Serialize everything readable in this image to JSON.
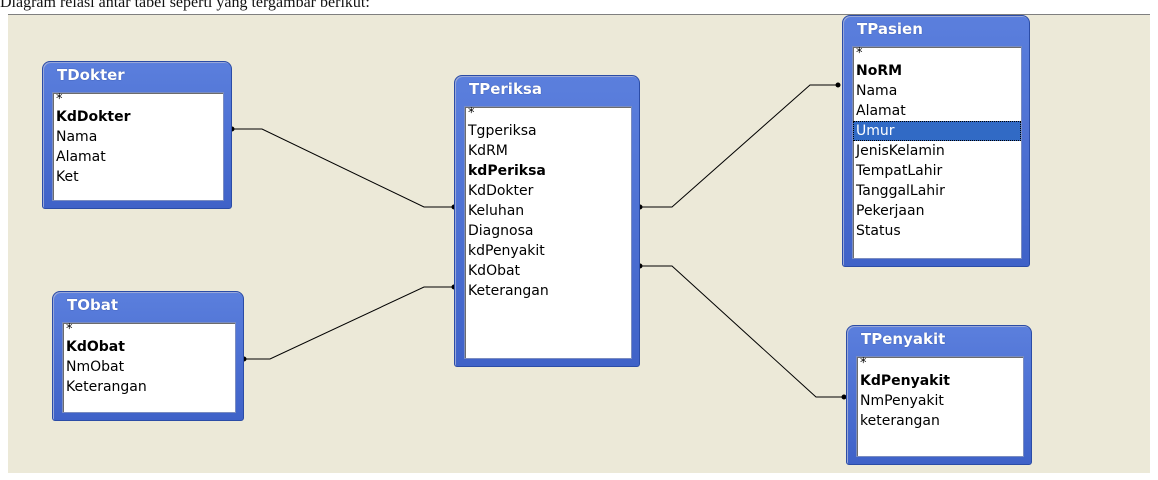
{
  "caption": "Diagram relasi antar tabel seperti yang tergambar berikut:",
  "tables": {
    "tdokter": {
      "title": "TDokter",
      "fields": [
        "*",
        "KdDokter",
        "Nama",
        "Alamat",
        "Ket"
      ]
    },
    "tobat": {
      "title": "TObat",
      "fields": [
        "*",
        "KdObat",
        "NmObat",
        "Keterangan"
      ]
    },
    "tperiksa": {
      "title": "TPeriksa",
      "fields": [
        "*",
        "Tgperiksa",
        "KdRM",
        "kdPeriksa",
        "KdDokter",
        "Keluhan",
        "Diagnosa",
        "kdPenyakit",
        "KdObat",
        "Keterangan"
      ]
    },
    "tpasien": {
      "title": "TPasien",
      "fields": [
        "*",
        "NoRM",
        "Nama",
        "Alamat",
        "Umur",
        "JenisKelamin",
        "TempatLahir",
        "TanggalLahir",
        "Pekerjaan",
        "Status"
      ],
      "selected": "Umur"
    },
    "tpenyakit": {
      "title": "TPenyakit",
      "fields": [
        "*",
        "KdPenyakit",
        "NmPenyakit",
        "keterangan"
      ]
    }
  },
  "colors": {
    "window_bg": "#ece9d8",
    "title_bar": "#4a6fd6",
    "selection": "#316ac5"
  }
}
